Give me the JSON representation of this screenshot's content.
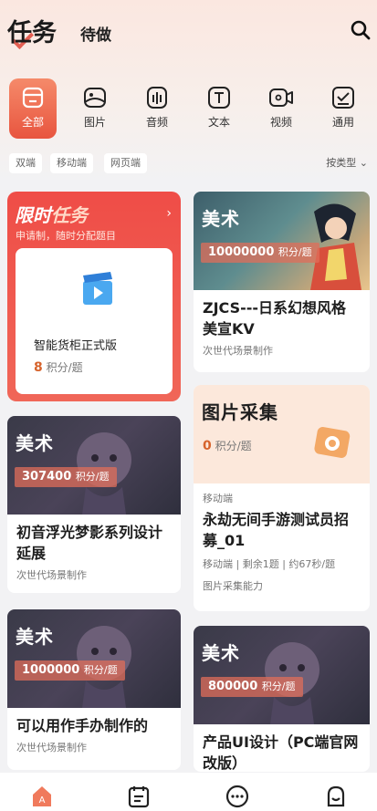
{
  "header": {
    "title": "任务",
    "tab": "待做"
  },
  "categories": [
    {
      "label": "全部",
      "icon": "all-icon",
      "active": true
    },
    {
      "label": "图片",
      "icon": "image-icon"
    },
    {
      "label": "音频",
      "icon": "audio-icon"
    },
    {
      "label": "文本",
      "icon": "text-icon"
    },
    {
      "label": "视频",
      "icon": "video-icon"
    },
    {
      "label": "通用",
      "icon": "general-icon"
    }
  ],
  "filters": {
    "chips": [
      "双端",
      "移动端",
      "网页端"
    ],
    "sort": "按类型"
  },
  "limited": {
    "title_a": "限时",
    "title_b": "任务",
    "subtitle": "申请制，随时分配题目",
    "task_name": "智能货柜正式版",
    "points": "8",
    "points_unit": "积分/题"
  },
  "cards": [
    {
      "tag": "美术",
      "points": "10000000",
      "points_unit": "积分/题",
      "title": "ZJCS---日系幻想风格美宣KV",
      "sub": "次世代场景制作"
    },
    {
      "tag": "美术",
      "points": "307400",
      "points_unit": "积分/题",
      "title": "初音浮光梦影系列设计延展",
      "sub": "次世代场景制作"
    },
    {
      "tag": "图片采集",
      "points": "0",
      "points_unit": "积分/题",
      "platform": "移动端",
      "title": "永劫无间手游测试员招募_01",
      "meta": [
        "移动端",
        "剩余1题",
        "约67秒/题"
      ],
      "sub": "图片采集能力"
    },
    {
      "tag": "美术",
      "points": "1000000",
      "points_unit": "积分/题",
      "title": "可以用作手办制作的",
      "sub": "次世代场景制作"
    },
    {
      "tag": "美术",
      "points": "800000",
      "points_unit": "积分/题",
      "title": "产品UI设计（PC端官网改版）",
      "sub": ""
    }
  ],
  "tabbar": [
    "home-icon",
    "tasks-icon",
    "message-icon",
    "profile-icon"
  ],
  "colors": {
    "accent": "#e8553f",
    "points": "#d6632c"
  }
}
